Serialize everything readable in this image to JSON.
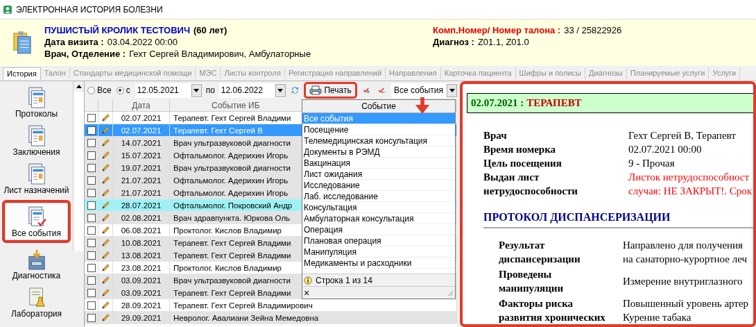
{
  "window": {
    "title": "ЭЛЕКТРОННАЯ ИСТОРИЯ БОЛЕЗНИ"
  },
  "patient": {
    "name": "ПУШИСТЫЙ КРОЛИК ТЕСТОВИЧ",
    "age": "(60 лет)",
    "visit_label": "Дата визита :",
    "visit": "03.04.2022 00:00",
    "doctor_label": "Врач, Отделение :",
    "doctor": "Гехт Сергей Владимирович, Амбулаторные",
    "number_label": "Комп.Номер/ Номер талона :",
    "number": "33 / 25822926",
    "diagnosis_label": "Диагноз :",
    "diagnosis": "Z01.1, Z01.0"
  },
  "tabs": [
    {
      "label": "История",
      "selected": true
    },
    {
      "label": "Талон",
      "selected": false
    },
    {
      "label": "Стандарты медицинской помощи",
      "selected": false
    },
    {
      "label": "МЭС",
      "selected": false
    },
    {
      "label": "Листы контроля",
      "selected": false
    },
    {
      "label": "Регистрация направлений",
      "selected": false
    },
    {
      "label": "Направления",
      "selected": false
    },
    {
      "label": "Карточка пациента",
      "selected": false
    },
    {
      "label": "Шифры и полисы",
      "selected": false
    },
    {
      "label": "Диагнозы",
      "selected": false
    },
    {
      "label": "Планируемые услуги",
      "selected": false
    },
    {
      "label": "Услуги",
      "selected": false
    }
  ],
  "sidebar": {
    "items": [
      {
        "label": "Протоколы",
        "kind": "protocol",
        "selected": false,
        "highlighted": false
      },
      {
        "label": "Заключения",
        "kind": "protocol",
        "selected": false,
        "highlighted": false
      },
      {
        "label": "Лист назначений",
        "kind": "protocol",
        "selected": false,
        "highlighted": false
      },
      {
        "label": "Все события",
        "kind": "checklist",
        "selected": true,
        "highlighted": true
      },
      {
        "label": "Диагностика",
        "kind": "cabinet",
        "selected": false,
        "highlighted": false
      },
      {
        "label": "Лаборатория",
        "kind": "lab",
        "selected": false,
        "highlighted": false
      }
    ]
  },
  "filter": {
    "period": [
      {
        "label": "Все",
        "selected": false
      },
      {
        "label": "с",
        "selected": true
      }
    ],
    "date_from": "12.05.2021",
    "to_label": "по",
    "date_to": "12.06.2022",
    "print_button": {
      "label": "Печать",
      "highlighted": true
    },
    "event_type": "Все события"
  },
  "table": {
    "columns": [
      "Дата",
      "Событие ИБ"
    ],
    "rows": [
      {
        "date": "02.07.2021",
        "event": "Терапевт. Гехт Сергей Владими",
        "checked": false,
        "selected": false,
        "kind": "plain"
      },
      {
        "date": "02.07.2021",
        "event": "Терапевт. Гехт Сергей В",
        "checked": false,
        "selected": true,
        "kind": "plain"
      },
      {
        "date": "14.07.2021",
        "event": "Врач ультразвуковой диагности",
        "checked": false,
        "selected": false,
        "kind": "shaded"
      },
      {
        "date": "15.07.2021",
        "event": "Офтальмолог. Адерихин Игорь",
        "checked": false,
        "selected": false,
        "kind": "shaded"
      },
      {
        "date": "19.07.2021",
        "event": "Врач ультразвуковой диагности",
        "checked": false,
        "selected": false,
        "kind": "shaded"
      },
      {
        "date": "21.07.2021",
        "event": "Офтальмолог. Адерихин Игорь",
        "checked": false,
        "selected": false,
        "kind": "shaded"
      },
      {
        "date": "21.07.2021",
        "event": "Офтальмолог. Адерихин Игорь",
        "checked": false,
        "selected": false,
        "kind": "shaded"
      },
      {
        "date": "28.07.2021",
        "event": "Офтальмолог. Покровский Андр",
        "checked": false,
        "selected": false,
        "kind": "marked"
      },
      {
        "date": "02.08.2021",
        "event": "Врач здравпункта. Юркова Оль",
        "checked": false,
        "selected": false,
        "kind": "shaded"
      },
      {
        "date": "06.08.2021",
        "event": "Проктолог. Кислов  Владимир",
        "checked": false,
        "selected": false,
        "kind": "plain"
      },
      {
        "date": "10.08.2021",
        "event": "Терапевт. Гехт Сергей Владими",
        "checked": false,
        "selected": false,
        "kind": "shaded"
      },
      {
        "date": "13.08.2021",
        "event": "Терапевт. Гехт Сергей Владими",
        "checked": false,
        "selected": false,
        "kind": "shaded"
      },
      {
        "date": "23.08.2021",
        "event": "Проктолог. Кислов  Владимир",
        "checked": false,
        "selected": false,
        "kind": "plain"
      },
      {
        "date": "03.09.2021",
        "event": "Врач ультразвуковой диагности",
        "checked": false,
        "selected": false,
        "kind": "shaded"
      },
      {
        "date": "03.09.2021",
        "event": "Терапевт. Гехт Сергей Владими",
        "checked": false,
        "selected": false,
        "kind": "shaded"
      },
      {
        "date": "28.09.2021",
        "event": "Терапевт. Гехт Сергей Владимирович",
        "checked": false,
        "selected": false,
        "kind": "plain"
      },
      {
        "date": "29.09.2021",
        "event": "Невролог. Авалиани Зейна Мемедовна",
        "checked": false,
        "selected": false,
        "kind": "shaded"
      }
    ]
  },
  "dropdown": {
    "column": "Событие",
    "options": [
      {
        "label": "Все события",
        "selected": true
      },
      {
        "label": "Посещение",
        "selected": false
      },
      {
        "label": "Телемедицинская консультация",
        "selected": false
      },
      {
        "label": "Документы в РЭМД",
        "selected": false
      },
      {
        "label": "Вакцинация",
        "selected": false
      },
      {
        "label": "Лист ожидания",
        "selected": false
      },
      {
        "label": "Исследование",
        "selected": false
      },
      {
        "label": "Лаб. исследование",
        "selected": false
      },
      {
        "label": "Консультация",
        "selected": false
      },
      {
        "label": "Амбулаторная консультация",
        "selected": false
      },
      {
        "label": "Операция",
        "selected": false
      },
      {
        "label": "Плановая операция",
        "selected": false
      },
      {
        "label": "Манипуляция",
        "selected": false
      },
      {
        "label": "Медикаменты и расходники",
        "selected": false
      }
    ],
    "status": "Строка 1 из 14",
    "close": "×"
  },
  "detail": {
    "highlighted": true,
    "heading_date": "02.07.2021 :",
    "heading_specialty": "ТЕРАПЕВТ",
    "fields": [
      {
        "label": "Врач",
        "lines": [
          "Гехт Сергей В, Терапевт"
        ],
        "alert": false
      },
      {
        "label": "Время номерка",
        "lines": [
          "02.07.2021 00:00"
        ],
        "alert": false
      },
      {
        "label": "Цель посещения",
        "lines": [
          "9 - Прочая"
        ],
        "alert": false
      },
      {
        "label": "Выдан лист нетрудоспособности",
        "lines": [
          "Листок нетрудоспособност",
          "случая: НЕ ЗАКРЫТ!. Срок"
        ],
        "alert": true
      }
    ],
    "section": "ПРОТОКОЛ ДИСПАНСЕРИЗАЦИИ",
    "section_fields": [
      {
        "label": "Результат диспансеризации",
        "lines": [
          "Направлено для получения",
          "на санаторно-курортное леч"
        ]
      },
      {
        "label": "Проведены манипуляции",
        "lines": [
          "Измерение внутриглазного"
        ]
      },
      {
        "label": "Факторы риска развития хронических",
        "lines": [
          "Повышенный уровень артер",
          "Курение табака"
        ]
      }
    ]
  }
}
